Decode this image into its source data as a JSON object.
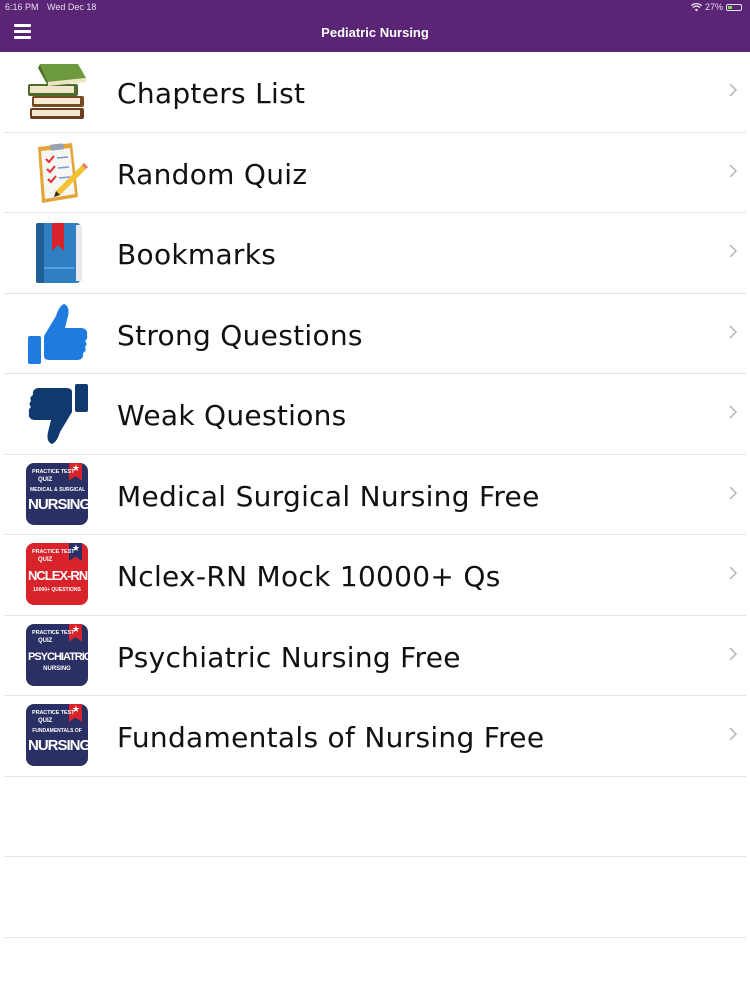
{
  "status_bar": {
    "time": "6:16 PM",
    "date": "Wed Dec 18",
    "battery": "27%",
    "battery_level": 0.27
  },
  "navbar": {
    "title": "Pediatric Nursing"
  },
  "colors": {
    "navbar_bg": "#5a2575",
    "separator": "#e4e4e4",
    "thumb_blue": "#1e7be0",
    "thumb_dark_blue": "#103a6e",
    "badge_navy": "#2a3063",
    "badge_red": "#d8232a"
  },
  "menu_items": [
    {
      "label": "Chapters List",
      "icon": "books-icon"
    },
    {
      "label": "Random Quiz",
      "icon": "quiz-clipboard-icon"
    },
    {
      "label": "Bookmarks",
      "icon": "bookmark-book-icon"
    },
    {
      "label": "Strong Questions",
      "icon": "thumbs-up-icon"
    },
    {
      "label": "Weak Questions",
      "icon": "thumbs-down-icon"
    },
    {
      "label": "Medical Surgical Nursing Free",
      "icon": "medical-surgical-app-icon",
      "badge": {
        "line1": "PRACTICE TEST",
        "line2": "QUIZ",
        "line3": "MEDICAL & SURGICAL",
        "line4": "NURSING"
      }
    },
    {
      "label": "Nclex-RN Mock 10000+ Qs",
      "icon": "nclex-app-icon",
      "badge": {
        "line1": "PRACTICE TEST",
        "line2": "QUIZ",
        "line3": "10000+ QUESTIONS",
        "line4": "NCLEX-RN"
      }
    },
    {
      "label": "Psychiatric Nursing Free",
      "icon": "psychiatric-app-icon",
      "badge": {
        "line1": "PRACTICE TEST",
        "line2": "QUIZ",
        "line3": "NURSING",
        "line4": "PSYCHIATRIC"
      }
    },
    {
      "label": "Fundamentals of Nursing Free",
      "icon": "fundamentals-app-icon",
      "badge": {
        "line1": "PRACTICE TEST",
        "line2": "QUIZ",
        "line3": "FUNDAMENTALS OF",
        "line4": "NURSING"
      }
    }
  ]
}
